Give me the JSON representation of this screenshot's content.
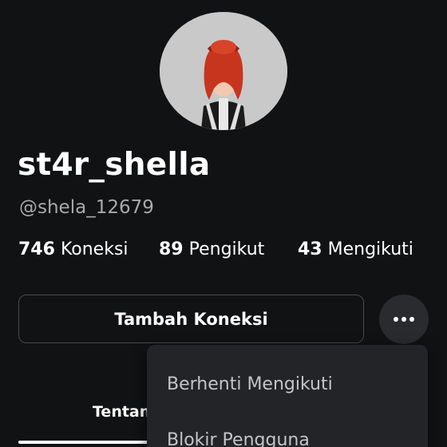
{
  "profile": {
    "display_name": "st4r_shella",
    "username": "@shela_12679",
    "avatar_icon": "user-avatar-icon"
  },
  "stats": [
    {
      "count": "746",
      "label": "Koneksi"
    },
    {
      "count": "89",
      "label": "Pengikut"
    },
    {
      "count": "43",
      "label": "Mengikuti"
    }
  ],
  "actions": {
    "add_connection_label": "Tambah Koneksi",
    "more_icon": "more-horizontal-icon"
  },
  "tabs": {
    "about_label": "Tentang"
  },
  "menu": {
    "items": [
      "Berhenti Mengikuti",
      "Blokir Pengguna"
    ]
  },
  "colors": {
    "background": "#111214",
    "button_border": "#4a4b4f",
    "menu_background": "#232427",
    "secondary_text": "#a8a9ab"
  }
}
